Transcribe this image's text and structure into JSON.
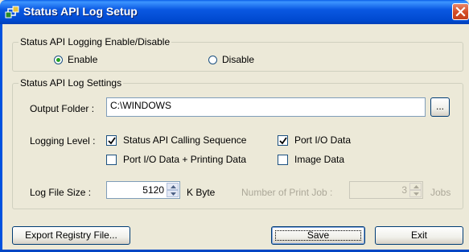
{
  "window": {
    "title": "Status API Log Setup",
    "close_icon": "close-icon"
  },
  "enable_group": {
    "legend": "Status API Logging Enable/Disable",
    "options": [
      {
        "label": "Enable",
        "selected": true
      },
      {
        "label": "Disable",
        "selected": false
      }
    ]
  },
  "settings_group": {
    "legend": "Status API Log Settings",
    "output_folder": {
      "label": "Output Folder :",
      "value": "C:\\WINDOWS",
      "browse_label": "..."
    },
    "logging_level": {
      "label": "Logging Level :",
      "options": [
        {
          "label": "Status API Calling Sequence",
          "checked": true
        },
        {
          "label": "Port I/O Data",
          "checked": true
        },
        {
          "label": "Port I/O Data + Printing Data",
          "checked": false
        },
        {
          "label": "Image Data",
          "checked": false
        }
      ]
    },
    "log_file_size": {
      "label": "Log File Size :",
      "value": "5120",
      "unit": "K Byte"
    },
    "print_jobs": {
      "label": "Number of Print Job :",
      "value": "3",
      "unit": "Jobs",
      "enabled": false
    }
  },
  "buttons": {
    "export": "Export Registry File...",
    "save": "Save",
    "exit": "Exit"
  },
  "colors": {
    "title_bar": "#0054e3",
    "dialog_bg": "#ece9d8",
    "close_button": "#d34a23",
    "check_mark": "#21a121"
  }
}
